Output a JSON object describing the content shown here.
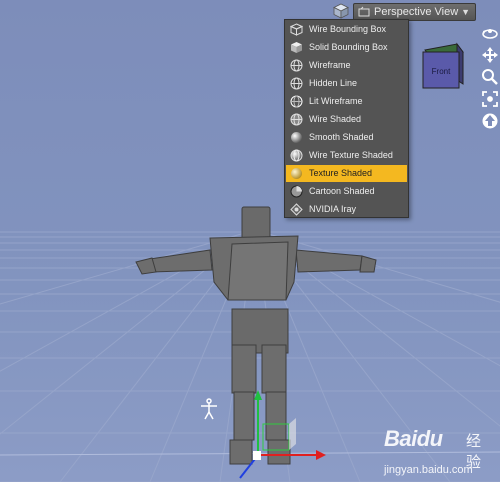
{
  "toolbar": {
    "view_dropdown": {
      "label": "Perspective View",
      "arrow": "▼"
    }
  },
  "menu": {
    "items": [
      {
        "label": "Wire Bounding Box",
        "icon": "wire-box-icon",
        "selected": false
      },
      {
        "label": "Solid Bounding Box",
        "icon": "solid-box-icon",
        "selected": false
      },
      {
        "label": "Wireframe",
        "icon": "wireframe-sphere-icon",
        "selected": false
      },
      {
        "label": "Hidden Line",
        "icon": "hidden-line-sphere-icon",
        "selected": false
      },
      {
        "label": "Lit Wireframe",
        "icon": "lit-wireframe-sphere-icon",
        "selected": false
      },
      {
        "label": "Wire Shaded",
        "icon": "wire-shaded-sphere-icon",
        "selected": false
      },
      {
        "label": "Smooth Shaded",
        "icon": "smooth-shaded-sphere-icon",
        "selected": false
      },
      {
        "label": "Wire Texture Shaded",
        "icon": "wire-texture-sphere-icon",
        "selected": false
      },
      {
        "label": "Texture Shaded",
        "icon": "texture-shaded-sphere-icon",
        "selected": true
      },
      {
        "label": "Cartoon Shaded",
        "icon": "cartoon-shaded-sphere-icon",
        "selected": false
      },
      {
        "label": "NVIDIA Iray",
        "icon": "nvidia-iray-icon",
        "selected": false
      }
    ]
  },
  "nav_cube": {
    "face_label": "Front"
  },
  "watermark": {
    "brand": "Baidu",
    "suffix": "经验",
    "url": "jingyan.baidu.com"
  },
  "colors": {
    "viewport_bg": "#8193bf",
    "selected_item": "#f4b820",
    "menu_bg": "#545454",
    "figure": "#6e6e6e",
    "axis_x": "#e02020",
    "axis_y": "#20c040",
    "axis_z": "#2040e0"
  }
}
